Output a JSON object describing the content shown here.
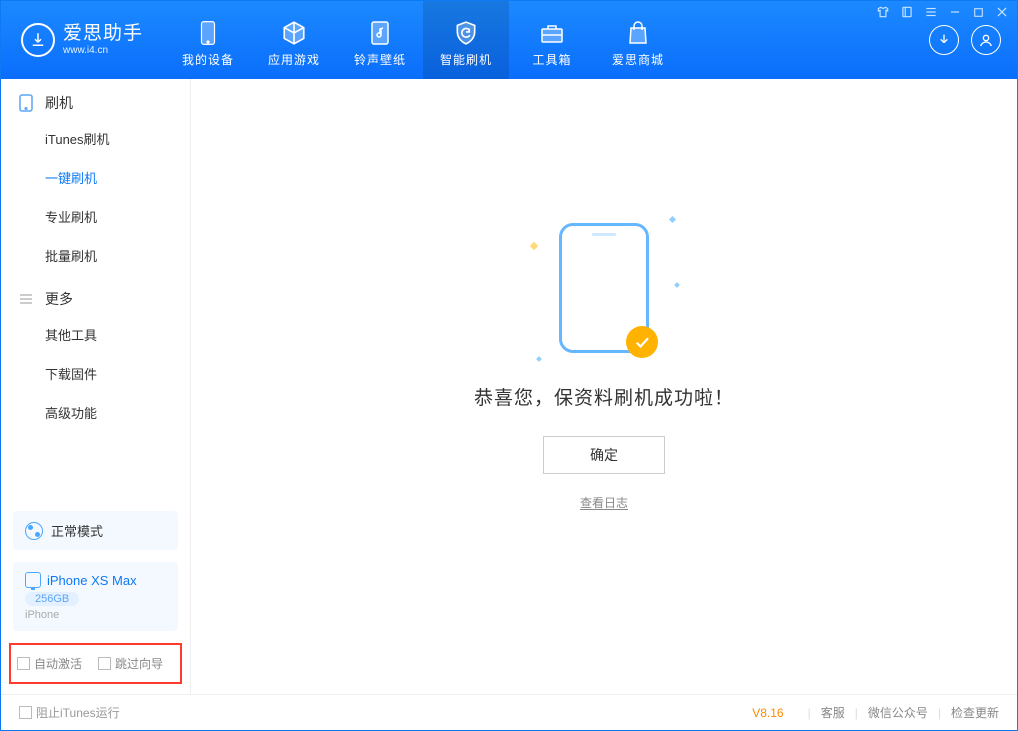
{
  "header": {
    "logo_title": "爱思助手",
    "logo_url": "www.i4.cn",
    "nav": [
      {
        "label": "我的设备"
      },
      {
        "label": "应用游戏"
      },
      {
        "label": "铃声壁纸"
      },
      {
        "label": "智能刷机"
      },
      {
        "label": "工具箱"
      },
      {
        "label": "爱思商城"
      }
    ]
  },
  "sidebar": {
    "section1_title": "刷机",
    "section1_items": [
      "iTunes刷机",
      "一键刷机",
      "专业刷机",
      "批量刷机"
    ],
    "section2_title": "更多",
    "section2_items": [
      "其他工具",
      "下载固件",
      "高级功能"
    ],
    "status_mode": "正常模式",
    "device_name": "iPhone XS Max",
    "device_capacity": "256GB",
    "device_type": "iPhone",
    "opt_auto_activate": "自动激活",
    "opt_skip_guide": "跳过向导"
  },
  "main": {
    "success_msg": "恭喜您，保资料刷机成功啦！",
    "ok_button": "确定",
    "view_log": "查看日志"
  },
  "footer": {
    "block_itunes": "阻止iTunes运行",
    "version": "V8.16",
    "link_support": "客服",
    "link_wechat": "微信公众号",
    "link_update": "检查更新"
  }
}
